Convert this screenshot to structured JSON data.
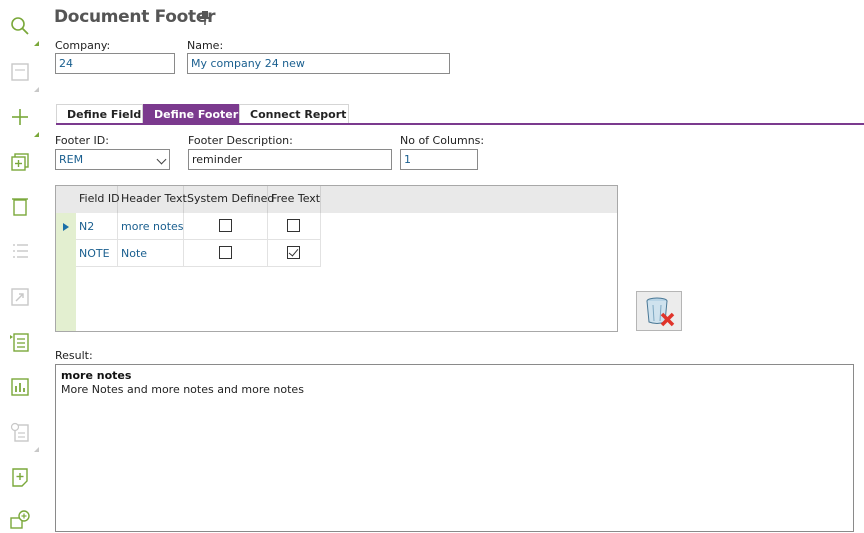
{
  "window": {
    "title": "Document Footer"
  },
  "toolbar": {
    "items": [
      "search-icon",
      "save-icon",
      "add-icon",
      "duplicate-icon",
      "delete-icon",
      "list-icon",
      "export-icon",
      "details-icon",
      "chart-icon",
      "info-icon",
      "new-note-icon",
      "comment-add-icon"
    ]
  },
  "form": {
    "company_label": "Company:",
    "company_value": "24",
    "name_label": "Name:",
    "name_value": "My company 24 new"
  },
  "tabs": [
    {
      "label": "Define Field",
      "active": false
    },
    {
      "label": "Define Footer",
      "active": true
    },
    {
      "label": "Connect Report",
      "active": false
    }
  ],
  "footer": {
    "id_label": "Footer ID:",
    "id_value": "REM",
    "desc_label": "Footer Description:",
    "desc_value": "reminder",
    "cols_label": "No of Columns:",
    "cols_value": "1"
  },
  "grid": {
    "headers": [
      "Field ID",
      "Header Text",
      "System Defined",
      "Free Text"
    ],
    "rows": [
      {
        "field_id": "N2",
        "header_text": "more notes",
        "system_defined": false,
        "free_text": false
      },
      {
        "field_id": "NOTE",
        "header_text": "Note",
        "system_defined": false,
        "free_text": true
      }
    ]
  },
  "result": {
    "label": "Result:",
    "title": "more notes",
    "body": "More Notes and more notes and more notes"
  },
  "colors": {
    "accent": "#7b3a8e",
    "link": "#1a5f8f",
    "toolbar_icon": "#7aa83a",
    "row_header": "#e3efd0"
  }
}
